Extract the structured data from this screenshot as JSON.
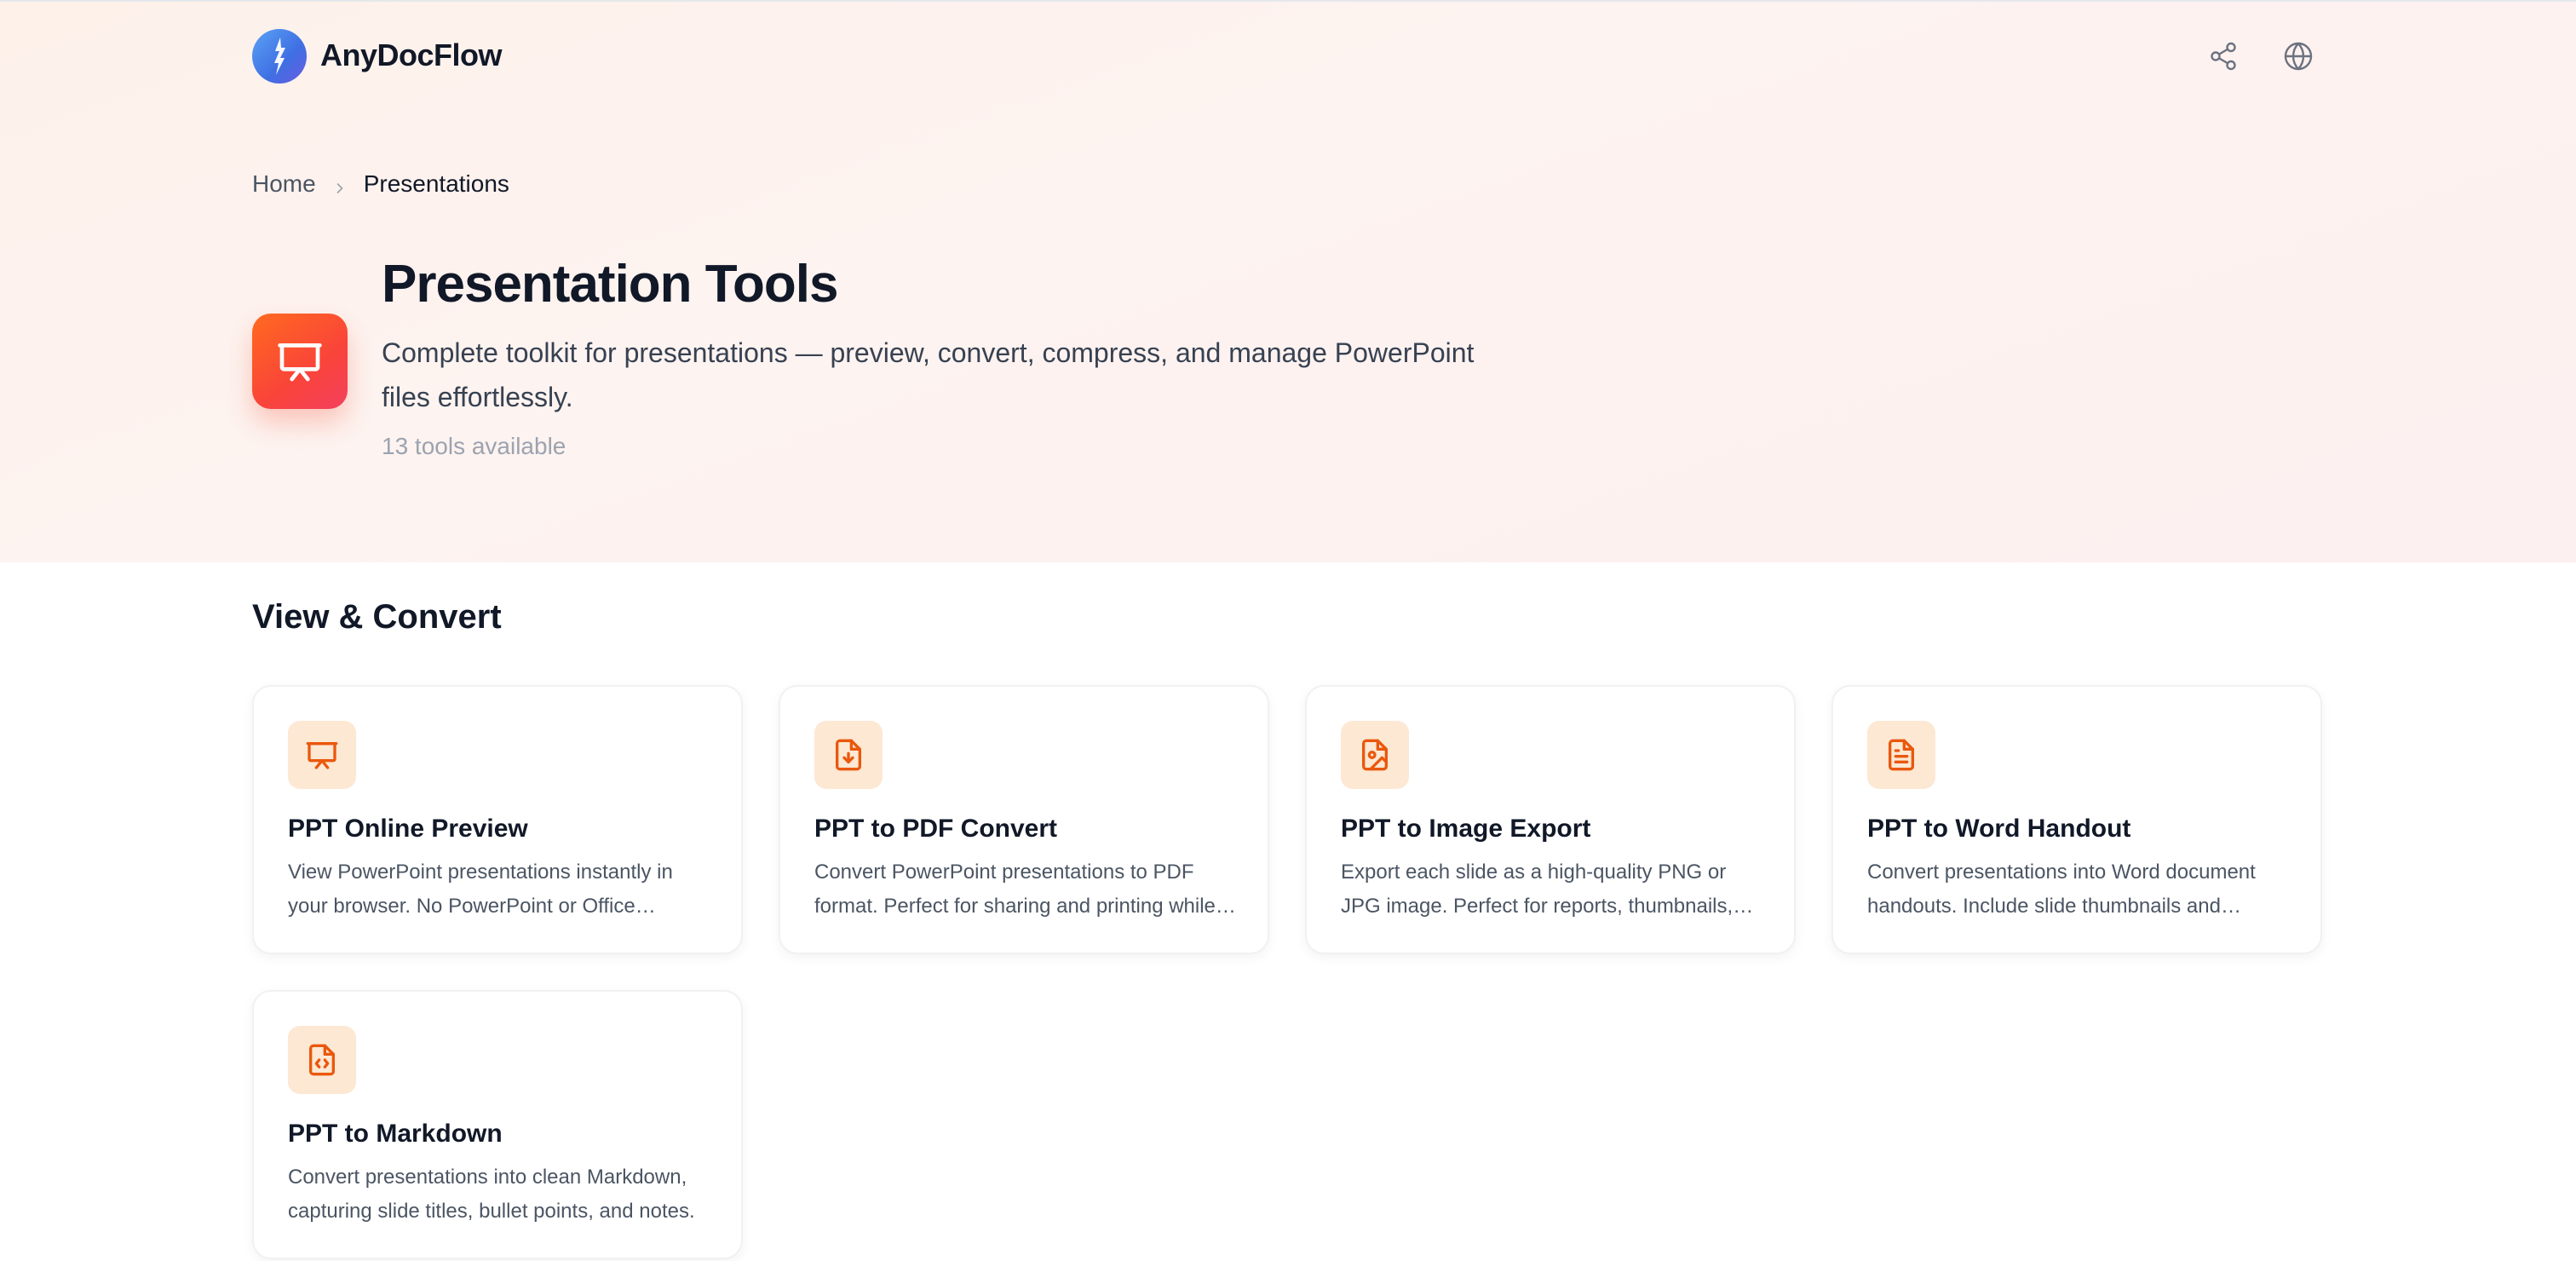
{
  "app": {
    "name": "AnyDocFlow",
    "logo_icon": "anydocflow-logo-icon"
  },
  "header": {
    "share_icon": "share-icon",
    "language_icon": "globe-icon"
  },
  "breadcrumb": {
    "home": "Home",
    "current": "Presentations"
  },
  "category": {
    "icon": "presentation-icon",
    "title": "Presentation Tools",
    "description": "Complete toolkit for presentations — preview, convert, compress, and manage PowerPoint files effortlessly.",
    "count_label": "13 tools available"
  },
  "section": {
    "title": "View & Convert"
  },
  "tools": [
    {
      "icon": "presentation-icon",
      "title": "PPT Online Preview",
      "description": "View PowerPoint presentations instantly in your browser. No PowerPoint or Office software needed."
    },
    {
      "icon": "file-download-icon",
      "title": "PPT to PDF Convert",
      "description": "Convert PowerPoint presentations to PDF format. Perfect for sharing and printing while keeping layout."
    },
    {
      "icon": "file-image-icon",
      "title": "PPT to Image Export",
      "description": "Export each slide as a high-quality PNG or JPG image. Perfect for reports, thumbnails, and social posts."
    },
    {
      "icon": "file-text-icon",
      "title": "PPT to Word Handout",
      "description": "Convert presentations into Word document handouts. Include slide thumbnails and speaker notes."
    },
    {
      "icon": "file-code-icon",
      "title": "PPT to Markdown",
      "description": "Convert presentations into clean Markdown, capturing slide titles, bullet points, and notes."
    }
  ],
  "colors": {
    "accent": "#ea580c",
    "category_gradient_start": "#ff6a1f",
    "category_gradient_end": "#f43f5e",
    "icon_tile_bg": "#fde8d4",
    "hero_bg": "#fdf1ea"
  }
}
